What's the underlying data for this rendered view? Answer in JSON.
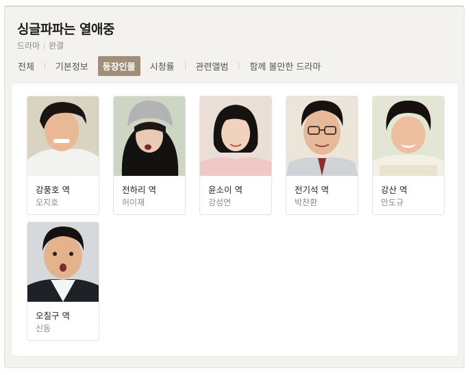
{
  "title": "싱글파파는 열애중",
  "meta": {
    "genre": "드라마",
    "status": "완결"
  },
  "tabs": [
    {
      "label": "전체",
      "active": false
    },
    {
      "label": "기본정보",
      "active": false
    },
    {
      "label": "등장인물",
      "active": true
    },
    {
      "label": "시청률",
      "active": false
    },
    {
      "label": "관련앨범",
      "active": false
    },
    {
      "label": "함께 볼만한 드라마",
      "active": false
    }
  ],
  "cast": [
    {
      "role": "강풍호 역",
      "actor": "오지호",
      "photo_icon": "actor-photo-icon"
    },
    {
      "role": "전하리 역",
      "actor": "허이재",
      "photo_icon": "actor-photo-icon"
    },
    {
      "role": "윤소이 역",
      "actor": "강성연",
      "photo_icon": "actor-photo-icon"
    },
    {
      "role": "전기석 역",
      "actor": "박찬환",
      "photo_icon": "actor-photo-icon"
    },
    {
      "role": "강산 역",
      "actor": "안도규",
      "photo_icon": "actor-photo-icon"
    },
    {
      "role": "오칠구 역",
      "actor": "신동",
      "photo_icon": "actor-photo-icon"
    }
  ],
  "colors": {
    "active_tab": "#a08f76",
    "panel_bg": "#f4f2ef"
  }
}
